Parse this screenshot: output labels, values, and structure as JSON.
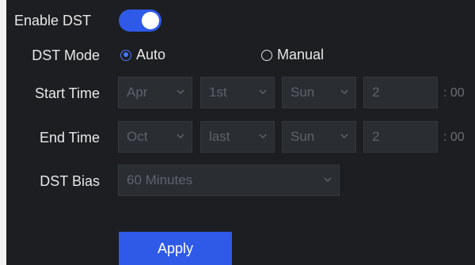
{
  "dst": {
    "enable_label": "Enable DST",
    "enabled": true,
    "mode_label": "DST Mode",
    "mode_options": [
      "Auto",
      "Manual"
    ],
    "mode_selected": "Auto",
    "start": {
      "label": "Start Time",
      "month": "Apr",
      "week": "1st",
      "day": "Sun",
      "hour": "2",
      "suffix": ": 00"
    },
    "end": {
      "label": "End Time",
      "month": "Oct",
      "week": "last",
      "day": "Sun",
      "hour": "2",
      "suffix": ": 00"
    },
    "bias_label": "DST Bias",
    "bias_value": "60 Minutes",
    "apply_label": "Apply"
  },
  "colors": {
    "accent": "#2f5ae8",
    "panel": "#1c1e21",
    "field": "#2a2d31",
    "text": "#e8e8e8",
    "disabled_text": "#5e636b"
  }
}
